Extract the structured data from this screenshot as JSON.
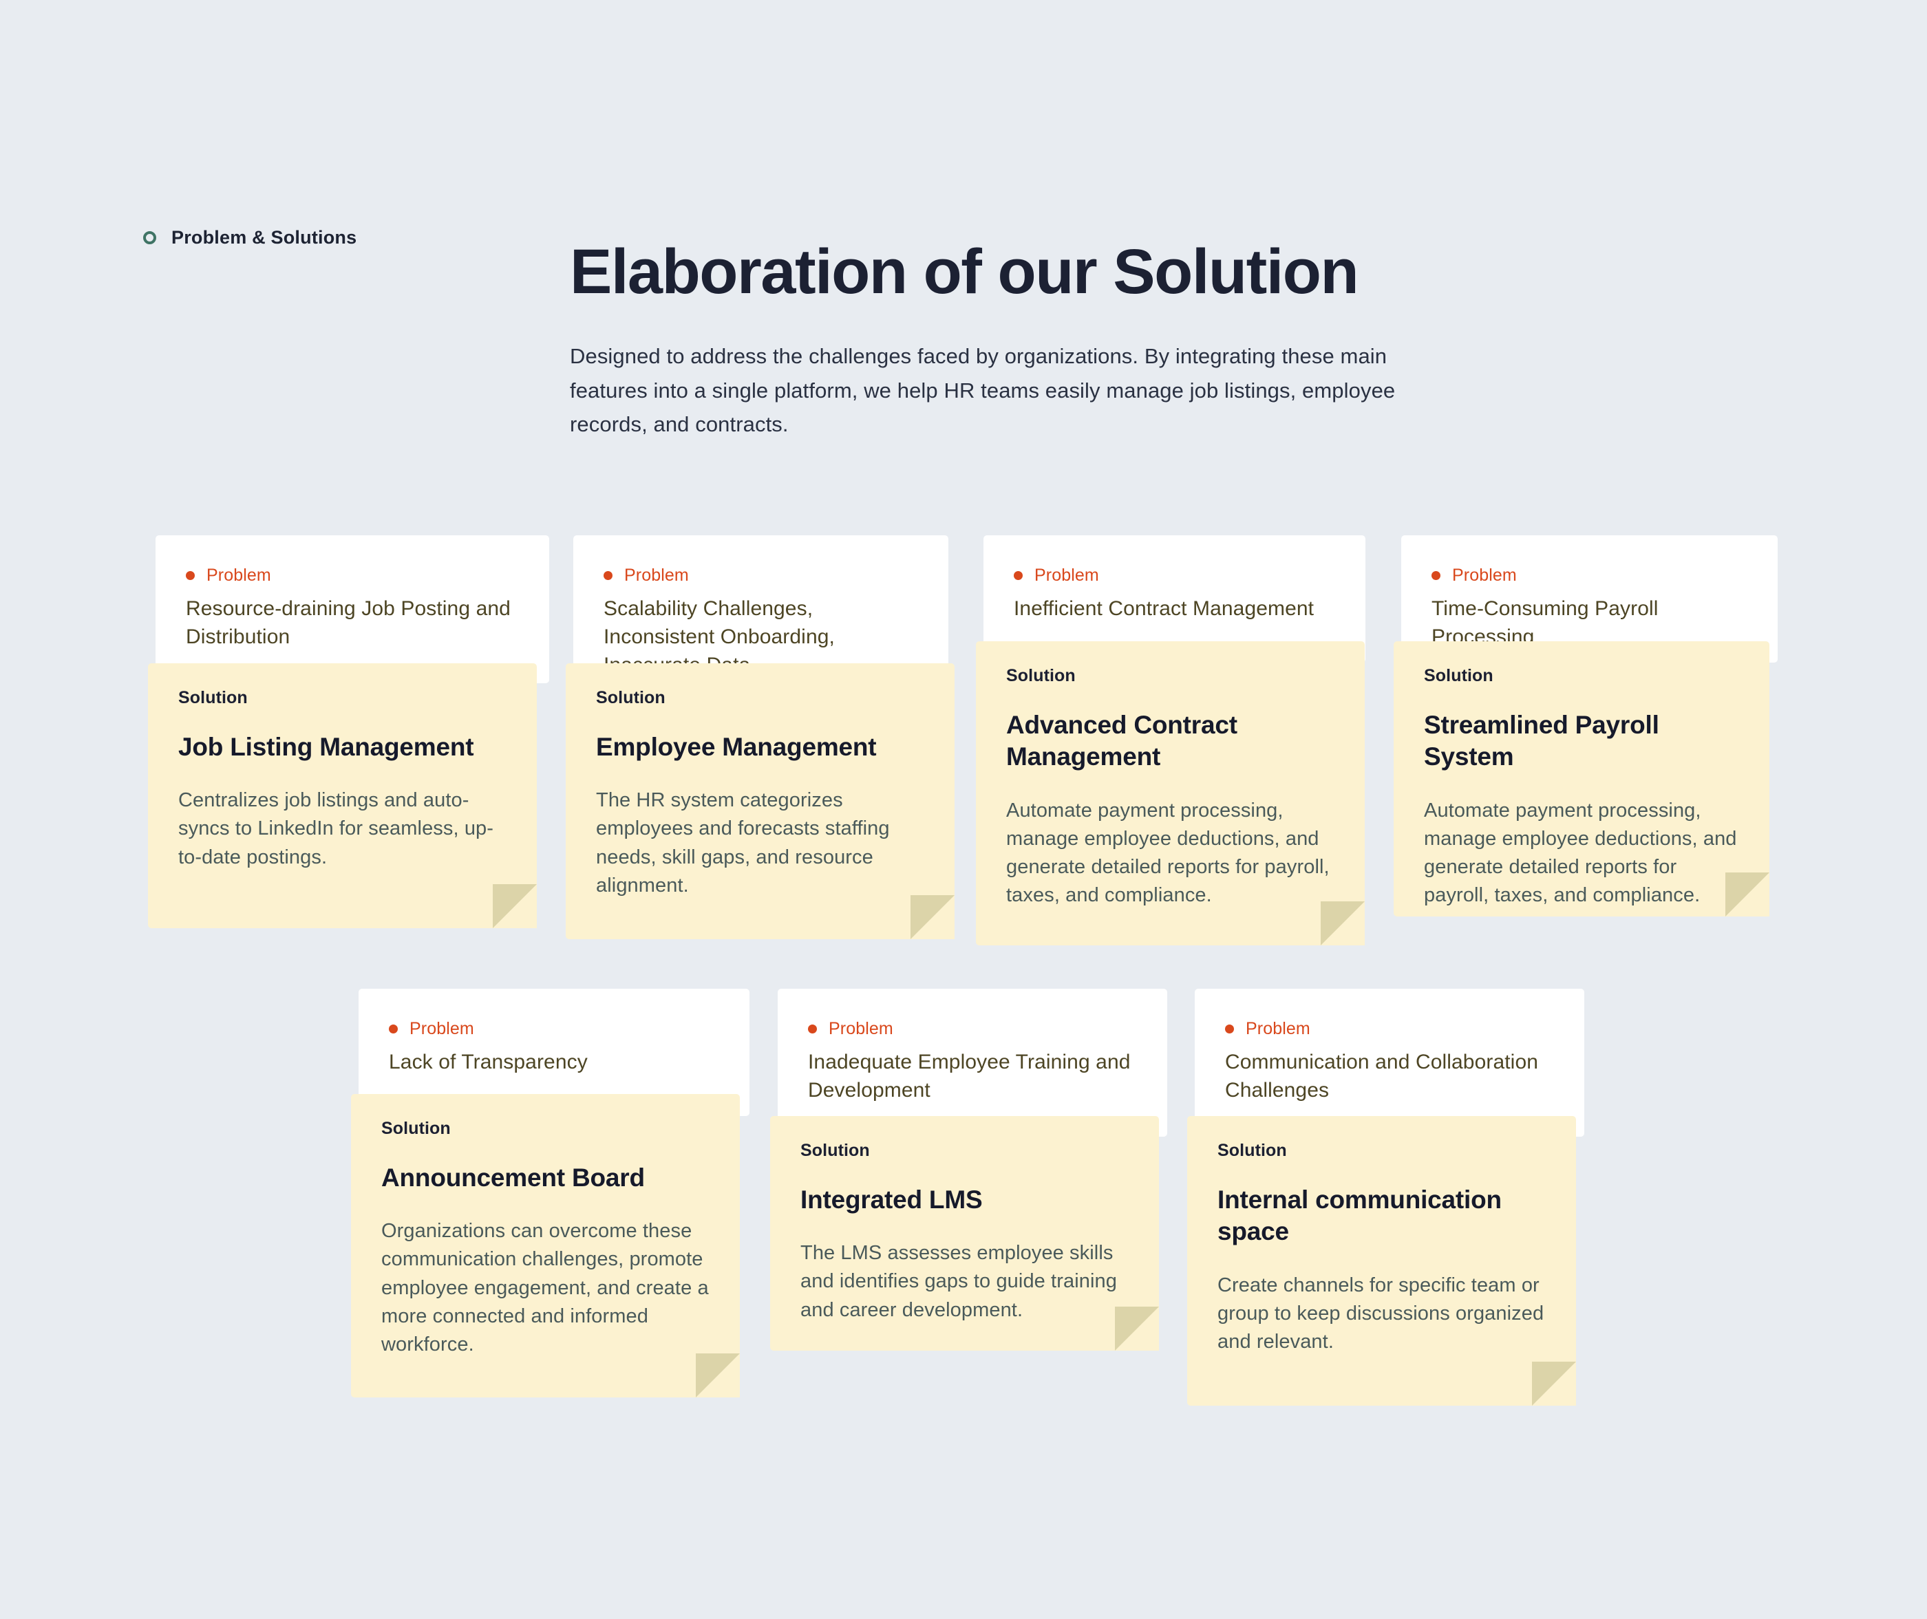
{
  "header": {
    "eyebrow": "Problem & Solutions",
    "eyebrow_icon": "ring-bullet-icon",
    "title": "Elaboration of our Solution",
    "subtitle": "Designed to address the challenges faced by organizations. By integrating these main features into a single platform, we help HR teams easily manage job listings, employee records, and contracts."
  },
  "labels": {
    "problem": "Problem",
    "solution": "Solution"
  },
  "colors": {
    "background": "#E8ECF1",
    "problem_card": "#FFFFFF",
    "solution_card": "#FCF2D0",
    "fold": "#DCD4A9",
    "accent_orange": "#D9481C",
    "accent_teal": "#3F7465",
    "heading": "#1C2133",
    "problem_text": "#4D4524",
    "solution_text": "#4A5A5A"
  },
  "cards": [
    {
      "problem": "Resource-draining Job Posting and Distribution",
      "solution_title": "Job Listing Management",
      "solution_body": "Centralizes job listings and auto-syncs to LinkedIn for seamless, up-to-date postings."
    },
    {
      "problem": "Scalability Challenges, Inconsistent Onboarding, Inaccurate Data",
      "solution_title": "Employee Management",
      "solution_body": "The HR system categorizes employees and forecasts staffing needs, skill gaps, and resource alignment."
    },
    {
      "problem": "Inefficient Contract Management",
      "solution_title": "Advanced Contract Management",
      "solution_body": "Automate payment processing, manage employee deductions, and generate detailed reports for payroll, taxes, and compliance."
    },
    {
      "problem": "Time-Consuming Payroll Processing",
      "solution_title": "Streamlined Payroll System",
      "solution_body": "Automate payment processing, manage employee deductions, and generate detailed reports for payroll, taxes, and compliance."
    },
    {
      "problem": "Lack of Transparency",
      "solution_title": "Announcement Board",
      "solution_body": "Organizations can overcome these communication challenges, promote employee engagement, and create a more connected and informed workforce."
    },
    {
      "problem": "Inadequate Employee Training and Development",
      "solution_title": "Integrated LMS",
      "solution_body": "The LMS assesses employee skills and identifies gaps to guide training and career development."
    },
    {
      "problem": "Communication and Collaboration Challenges",
      "solution_title": "Internal communication space",
      "solution_body": "Create channels for specific team or group to keep discussions organized and relevant."
    }
  ]
}
